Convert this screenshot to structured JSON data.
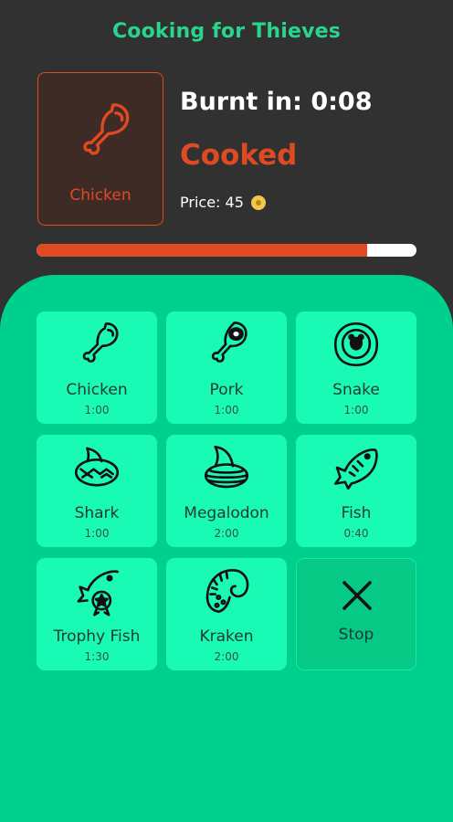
{
  "app": {
    "title": "Cooking for Thieves"
  },
  "current": {
    "item": "Chicken",
    "burnt_label": "Burnt in: 0:08",
    "status": "Cooked",
    "price_label": "Price: 45",
    "progress_fraction": 0.87
  },
  "items": [
    {
      "name": "Chicken",
      "time": "1:00",
      "icon": "chicken-leg-icon"
    },
    {
      "name": "Pork",
      "time": "1:00",
      "icon": "pork-leg-icon"
    },
    {
      "name": "Snake",
      "time": "1:00",
      "icon": "snake-icon"
    },
    {
      "name": "Shark",
      "time": "1:00",
      "icon": "shark-icon"
    },
    {
      "name": "Megalodon",
      "time": "2:00",
      "icon": "megalodon-icon"
    },
    {
      "name": "Fish",
      "time": "0:40",
      "icon": "fish-icon"
    },
    {
      "name": "Trophy Fish",
      "time": "1:30",
      "icon": "trophy-fish-icon"
    },
    {
      "name": "Kraken",
      "time": "2:00",
      "icon": "kraken-tentacle-icon"
    }
  ],
  "stop": {
    "label": "Stop",
    "icon": "close-icon"
  },
  "colors": {
    "accent": "#29d48c",
    "cooked": "#e04a23",
    "panel": "#00d08d",
    "tile": "#19fbb5",
    "background": "#313131"
  }
}
